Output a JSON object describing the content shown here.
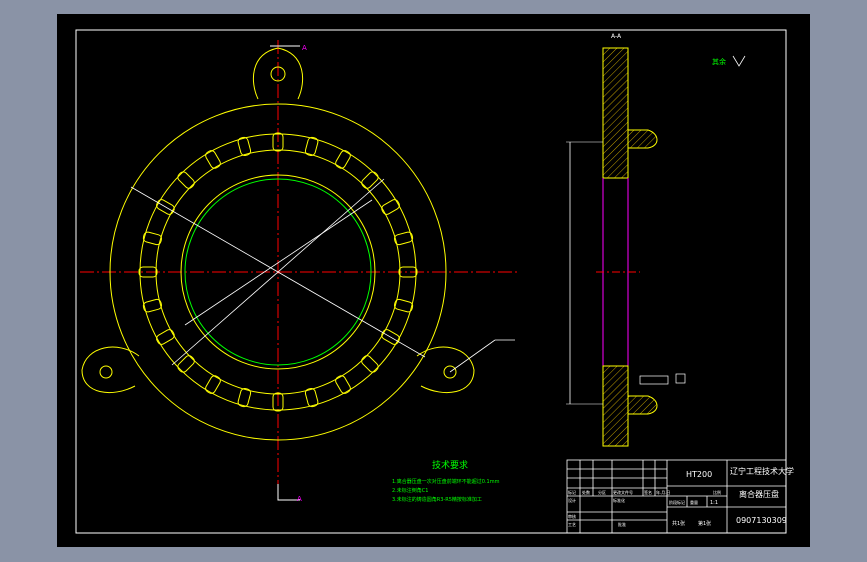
{
  "colors": {
    "viewport_bg": "#8a93a6",
    "paper_bg": "#000000",
    "frame": "#ffffff",
    "outline": "#ffff00",
    "centerline": "#ff0000",
    "dimension": "#00ff00",
    "hatch": "#c0a000",
    "section": "#ff00ff",
    "note_text": "#00ff00",
    "section_mark": "#ff00ff"
  },
  "section_marks": {
    "top": "A",
    "bottom": "A",
    "side_view": "A-A"
  },
  "roughness_note": "其余",
  "tech_requirements": {
    "title": "技术要求",
    "items": [
      "1.离合器压盘一次对压盘前端环不能超过0.1mm",
      "2.未标注倒角C1",
      "3.未标注的铸造圆角R3-R5精按标准加工"
    ]
  },
  "title_block": {
    "material": "HT200",
    "school": "辽宁工程技术大学",
    "part_name": "离合器压盘",
    "drawing_no": "0907130309",
    "row_labels": [
      "标记",
      "处数",
      "分区",
      "更改文件号",
      "签名",
      "年.月.日"
    ],
    "staff_labels": [
      "设计",
      "标准化"
    ],
    "review_labels": [
      "审核",
      "工艺",
      "批准"
    ],
    "stage_labels": [
      "阶段标记",
      "重量",
      "比例"
    ],
    "scale": "1:1",
    "sheet": [
      "共1张",
      "第1张"
    ]
  }
}
